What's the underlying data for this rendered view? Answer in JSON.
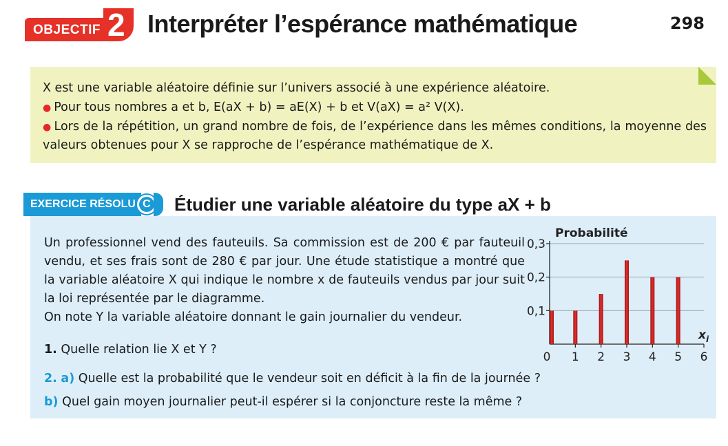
{
  "header": {
    "objectif_word": "OBJECTIF",
    "objectif_number": "2",
    "title": "Interpréter l’espérance mathématique",
    "page_number": "298"
  },
  "theory": {
    "line1": "X est une variable aléatoire définie sur l’univers associé à une expérience aléatoire.",
    "line2": "Pour tous nombres a et b, E(aX + b) = aE(X) + b     et     V(aX) = a² V(X).",
    "line3": "Lors de la répétition, un grand nombre de fois, de l’expérience dans les mêmes conditions, la moyenne des valeurs obtenues pour X se rapproche de l’espérance mathématique de X."
  },
  "exercise": {
    "badge_word": "EXERCICE RÉSOLU",
    "badge_letter": "C",
    "title": "Étudier une variable aléatoire du type aX + b",
    "statement_1": "Un professionnel vend des fauteuils. Sa commission est de 200 € par fauteuil vendu, et ses frais sont de 280 € par jour. Une étude statistique a montré que la variable aléatoire X qui indique le nombre x de fauteuils vendus par jour suit la loi représentée par le diagramme.",
    "statement_2": "On note Y la variable aléatoire donnant le gain journalier du vendeur.",
    "q1_num": "1.",
    "q1_text": " Quelle relation lie X et Y ?",
    "q2_num": "2.",
    "q2_sub": "a)",
    "q2_text": " Quelle est la probabilité que le vendeur soit en déficit à la fin de la journée ?",
    "q3_sub": "b)",
    "q3_text": " Quel gain moyen journalier peut-il espérer si la conjoncture reste la même ?"
  },
  "colors": {
    "red": "#e53127",
    "blue": "#1a9ad6",
    "theory_bg": "#f0f3c0",
    "exercise_bg": "#ddeef9"
  },
  "chart_data": {
    "type": "bar",
    "ylabel": "Probabilité",
    "xlabel": "xi",
    "x": [
      0,
      1,
      2,
      3,
      4,
      5
    ],
    "values": [
      0.1,
      0.1,
      0.15,
      0.25,
      0.2,
      0.2
    ],
    "xlim": [
      0,
      6
    ],
    "ylim": [
      0,
      0.3
    ],
    "xticks": [
      "0",
      "1",
      "2",
      "3",
      "4",
      "5",
      "6"
    ],
    "yticks": [
      "0,1",
      "0,2",
      "0,3"
    ],
    "ytick_values": [
      0.1,
      0.2,
      0.3
    ],
    "grid": true
  }
}
